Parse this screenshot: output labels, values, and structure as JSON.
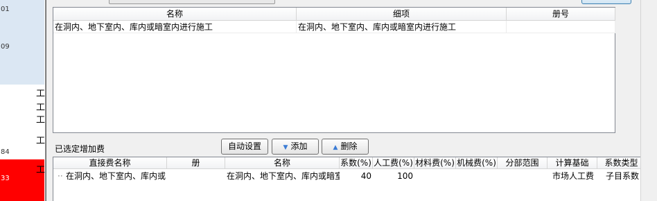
{
  "left_strip": {
    "numbers": [
      "01",
      "09",
      "84",
      "33"
    ],
    "glyphs": [
      "工",
      "工",
      "工",
      "工",
      "工"
    ]
  },
  "top_table": {
    "headers": [
      "名称",
      "细项",
      "册号"
    ],
    "rows": [
      {
        "name": "在洞内、地下室内、库内或暗室内进行施工",
        "detail": "在洞内、地下室内、库内或暗室内进行施工",
        "volume": ""
      }
    ]
  },
  "selected_section": {
    "label": "已选定增加费",
    "buttons": {
      "auto": "自动设置",
      "add": "添加",
      "delete": "删除"
    }
  },
  "bottom_table": {
    "headers": [
      "直接费名称",
      "册",
      "名称",
      "系数(%)",
      "人工费(%)",
      "材料费(%)",
      "机械费(%)",
      "分部范围",
      "计算基础",
      "系数类型"
    ],
    "row": {
      "direct_name": "在洞内、地下室内、库内或",
      "volume": "",
      "name": "在洞内、地下室内、库内或暗室",
      "coef": "40",
      "labor": "100",
      "material": "",
      "machine": "",
      "scope": "",
      "basis": "市场人工费",
      "coef_type": "子目系数"
    }
  }
}
